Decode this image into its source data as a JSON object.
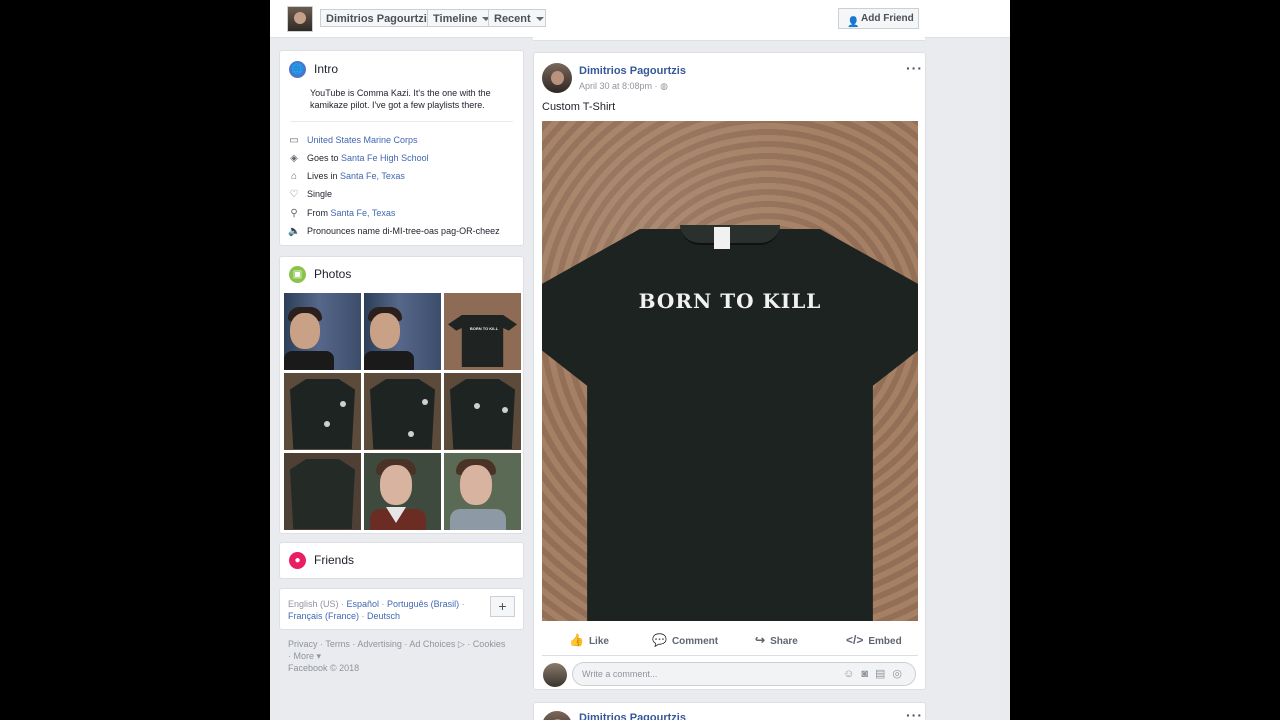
{
  "header": {
    "profile_name": "Dimitrios Pagourtzis",
    "timeline_label": "Timeline",
    "recent_label": "Recent",
    "add_friend_label": "Add Friend",
    "icons": [
      "avatar",
      "chevron-down-icon",
      "add-friend-icon"
    ]
  },
  "intro": {
    "title": "Intro",
    "description": "YouTube is Comma Kazi. It's the one with the kamikaze pilot. I've got a few playlists there.",
    "items": [
      {
        "icon": "briefcase-icon",
        "prefix": "",
        "link": "United States Marine Corps"
      },
      {
        "icon": "graduation-cap-icon",
        "prefix": "Goes to ",
        "link": "Santa Fe High School"
      },
      {
        "icon": "home-icon",
        "prefix": "Lives in ",
        "link": "Santa Fe, Texas"
      },
      {
        "icon": "heart-icon",
        "prefix": "Single",
        "link": ""
      },
      {
        "icon": "location-pin-icon",
        "prefix": "From ",
        "link": "Santa Fe, Texas"
      },
      {
        "icon": "speaker-icon",
        "prefix": "Pronounces name di-MI-tree-oas pag-OR-cheez",
        "link": ""
      }
    ]
  },
  "photos": {
    "title": "Photos",
    "thumb_text": "BORN TO KILL"
  },
  "friends": {
    "title": "Friends"
  },
  "languages": {
    "line1": [
      "English (US)",
      "Español",
      "Português (Brasil)"
    ],
    "line2": [
      "Français (France)",
      "Deutsch"
    ],
    "plus_label": "+"
  },
  "footer": {
    "line1": "Privacy · Terms · Advertising · Ad Choices ▷ · Cookies",
    "line2": "· More ▾",
    "copyright": "Facebook © 2018"
  },
  "post": {
    "author": "Dimitrios Pagourtzis",
    "date": "April 30 at 8:08pm ·",
    "privacy_icon": "globe-icon",
    "text": "Custom T-Shirt",
    "shirt_text": "BORN TO KILL",
    "actions": {
      "like": "Like",
      "comment": "Comment",
      "share": "Share",
      "embed": "Embed"
    },
    "comment_placeholder": "Write a comment..."
  },
  "next_post": {
    "author": "Dimitrios Pagourtzis"
  },
  "colors": {
    "link": "#4267b2",
    "name": "#365899",
    "page_bg": "#e9ebee",
    "intro_icon": "#4a76c9",
    "photos_icon": "#8bc34a",
    "friends_icon": "#e91e63"
  }
}
